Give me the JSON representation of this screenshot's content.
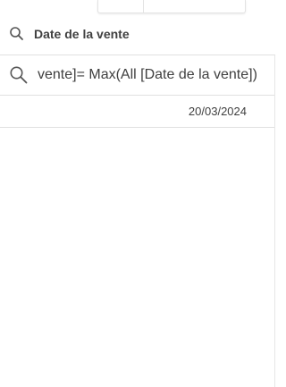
{
  "header": {
    "title": "Date de la vente",
    "icon": "search-icon"
  },
  "search": {
    "query": "vente]= Max(All [Date de la vente])",
    "icon": "search-icon"
  },
  "rows": [
    {
      "value": "20/03/2024"
    }
  ]
}
